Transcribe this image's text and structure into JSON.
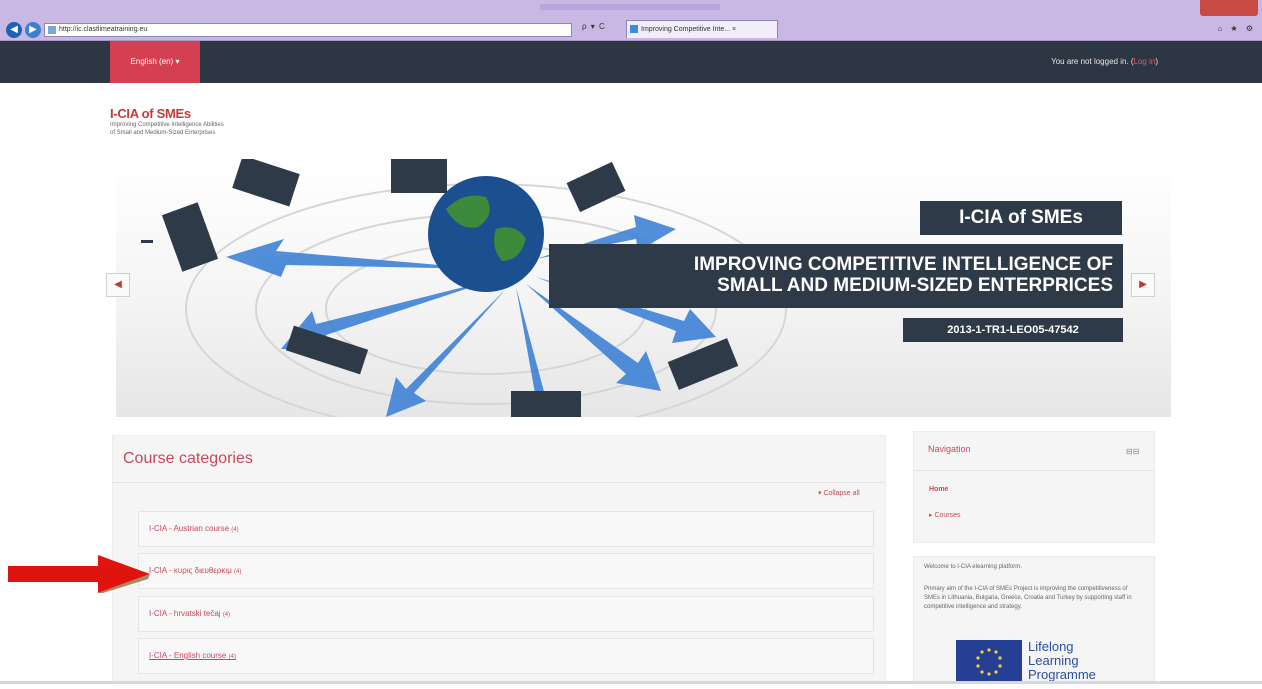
{
  "browser": {
    "address": "http://ic.clastlimeatraining.eu",
    "address_tools": "ρ ▾ C",
    "tab_title": "Improving Competitive Inte... ×",
    "back_glyph": "◀",
    "forward_glyph": "▶",
    "window_tools": "⌂ ★ ⚙"
  },
  "topbar": {
    "language": "English (en) ▾",
    "login_prefix": "You are not logged in. (",
    "login_link": "Log in",
    "login_suffix": ")",
    "color_bg": "#2d3643",
    "color_accent": "#d43f51"
  },
  "logo": {
    "title": "I-CIA of SMEs",
    "sub1": "Improving Competitive Intelligence Abilities",
    "sub2": "of Small and Medium-Sized Enterprises"
  },
  "banner": {
    "title": "I-CIA of SMEs",
    "line1": "IMPROVING COMPETITIVE INTELLIGENCE OF",
    "line2": "SMALL AND MEDIUM-SIZED ENTERPRICES",
    "code": "2013-1-TR1-LEO05-47542",
    "prev_glyph": "◀",
    "next_glyph": "▶"
  },
  "course_categories": {
    "title": "Course categories",
    "collapse_all": "▾ Collapse all",
    "items": [
      {
        "label": "I-CIA - Austrian course",
        "count": "(4)"
      },
      {
        "label": "I-CIA - κυρις διευθερκιμ",
        "count": "(4)"
      },
      {
        "label": "I-CIA - hrvatski tečaj",
        "count": "(4)"
      },
      {
        "label": "I-CIA - English course",
        "count": "(4)"
      }
    ]
  },
  "navigation": {
    "title": "Navigation",
    "dock_glyph": "⊟⊟",
    "home": "Home",
    "courses": "▸ Courses"
  },
  "welcome": {
    "line1": "Welcome to I-CIA elearning platform.",
    "line2": "Primary aim of the I-CIA of SMEs Project is improving the competitiveness of SMEs in Lithuania, Bulgaria, Greece, Croatia and Turkey by supporting staff in competitive intelligence and strategy.",
    "llp_1": "Lifelong",
    "llp_2": "Learning",
    "llp_3": "Programme"
  }
}
